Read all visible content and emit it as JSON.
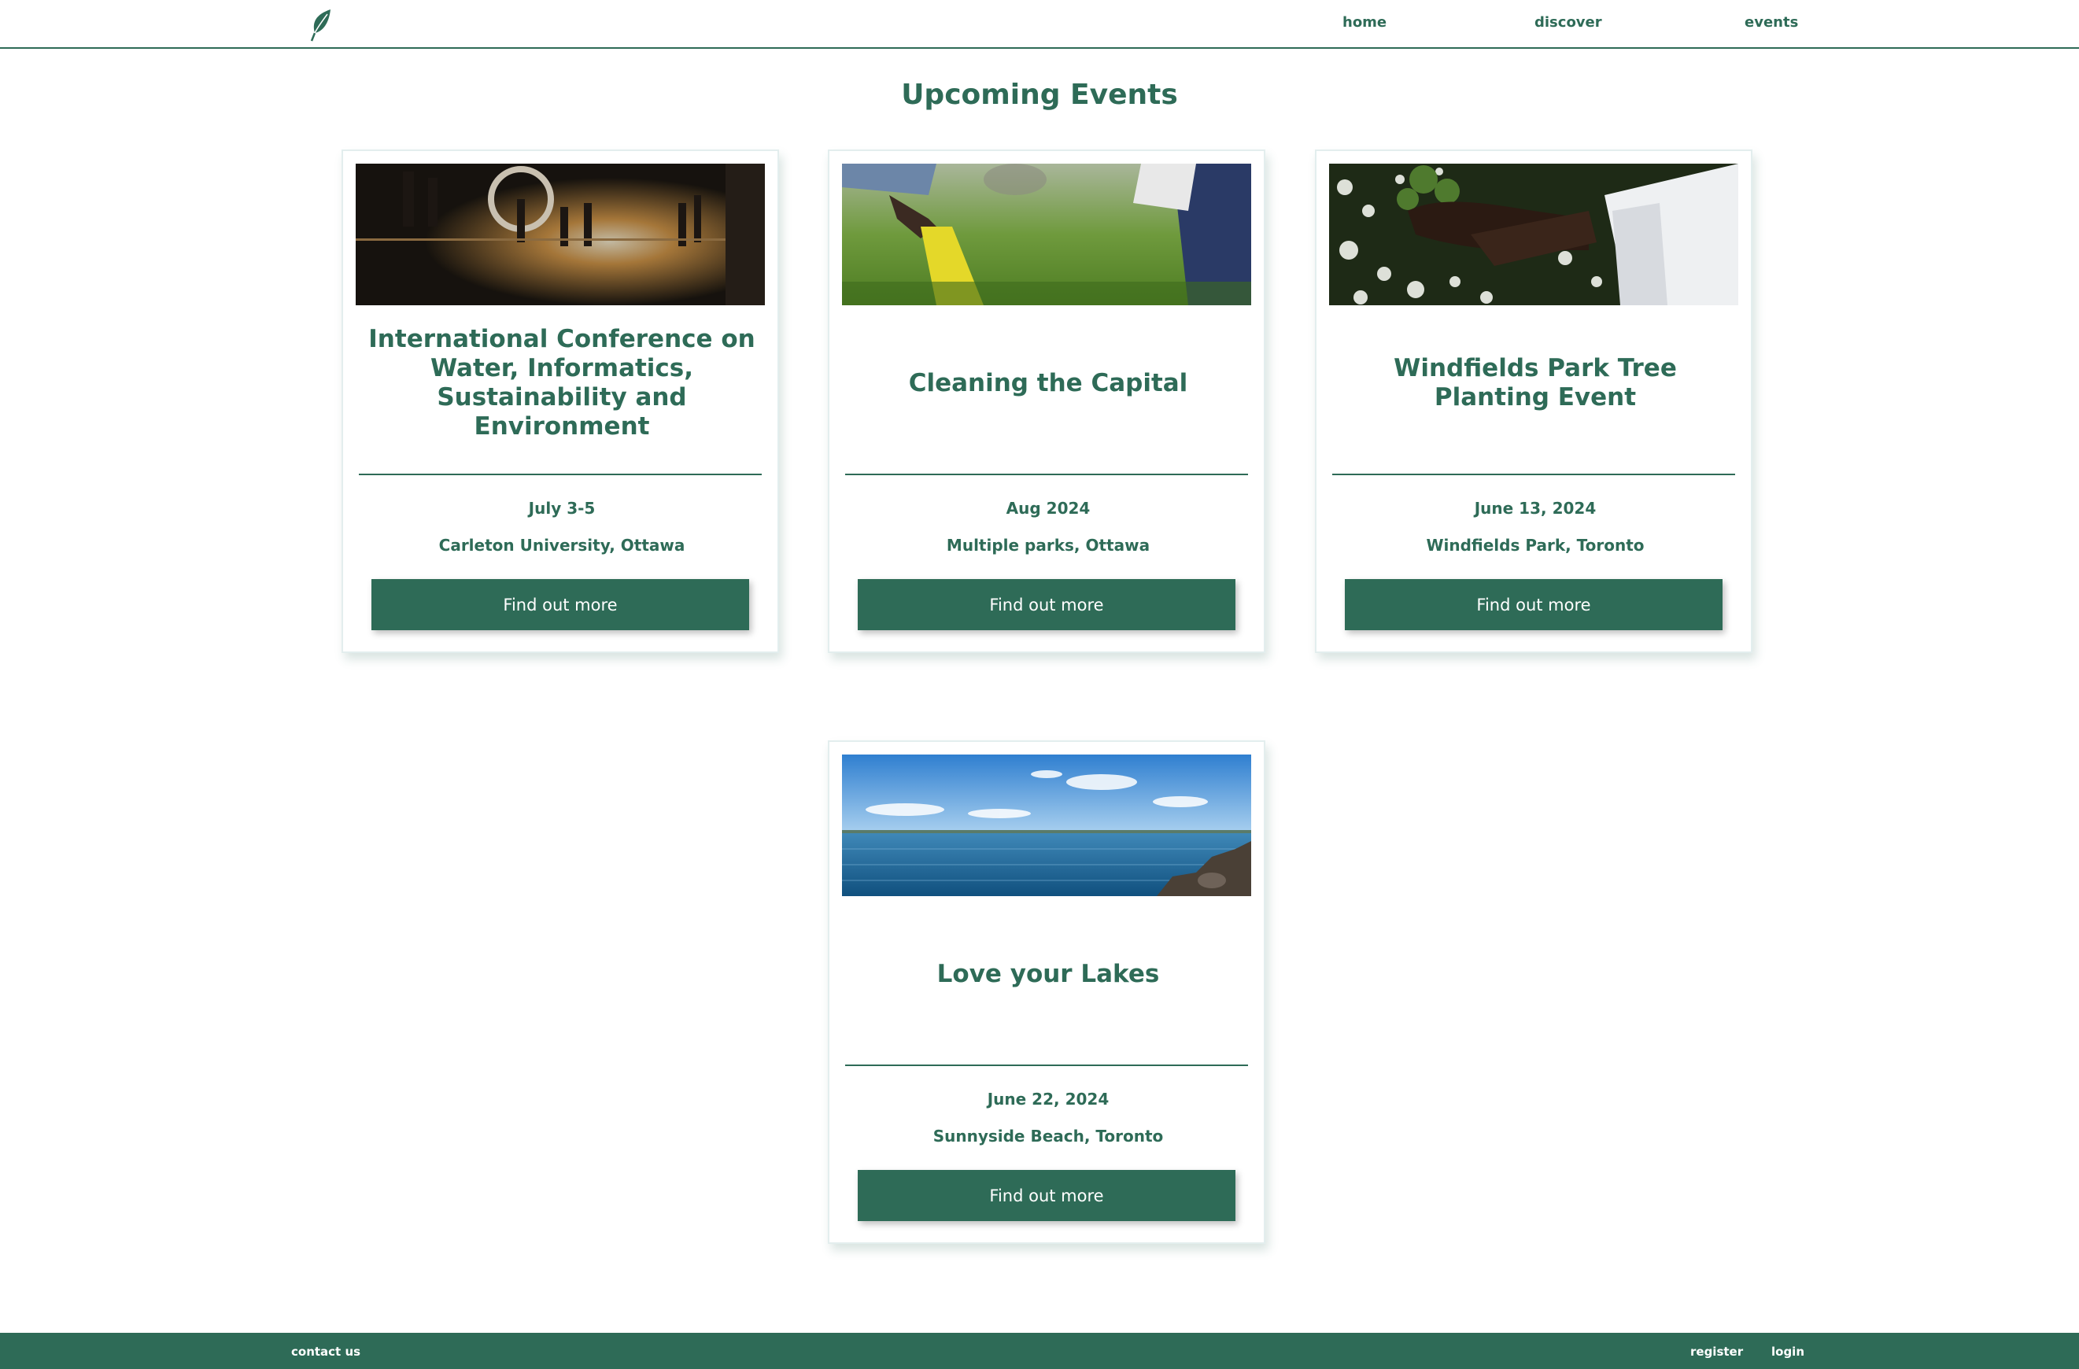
{
  "nav": {
    "logo": "leaf-icon",
    "links": [
      {
        "label": "home"
      },
      {
        "label": "discover"
      },
      {
        "label": "events"
      }
    ]
  },
  "page": {
    "title": "Upcoming Events"
  },
  "events": [
    {
      "title": "International Conference on Water, Informatics, Sustainability and Environment",
      "date": "July 3-5",
      "location": "Carleton University, Ottawa",
      "button_label": "Find out more",
      "image": "conference-hall-photo"
    },
    {
      "title": "Cleaning the Capital",
      "date": "Aug 2024",
      "location": "Multiple parks, Ottawa",
      "button_label": "Find out more",
      "image": "gloved-hand-on-grass-photo"
    },
    {
      "title": "Windfields Park Tree Planting Event",
      "date": "June 13, 2024",
      "location": "Windfields Park, Toronto",
      "button_label": "Find out more",
      "image": "hands-holding-seedling-photo"
    },
    {
      "title": "Love your Lakes",
      "date": "June 22, 2024",
      "location": "Sunnyside Beach, Toronto",
      "button_label": "Find out more",
      "image": "lake-shoreline-photo"
    }
  ],
  "footer": {
    "contact_label": "contact us",
    "register_label": "register",
    "login_label": "login"
  },
  "colors": {
    "brand": "#2e6b57",
    "background": "#ffffff",
    "button_text": "#ffffff"
  }
}
